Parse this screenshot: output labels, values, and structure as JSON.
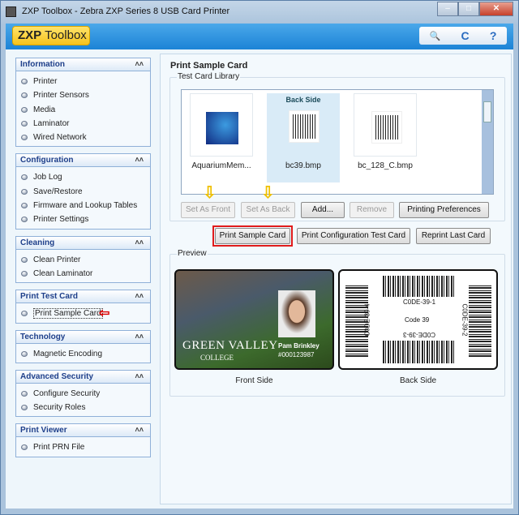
{
  "window": {
    "title": "ZXP Toolbox - Zebra ZXP Series 8 USB Card Printer"
  },
  "header": {
    "logo_bold": "ZXP",
    "logo_rest": " Toolbox",
    "tools": [
      {
        "icon": "search-document-icon",
        "glyph": "🔍"
      },
      {
        "icon": "refresh-icon",
        "glyph": "C"
      },
      {
        "icon": "help-icon",
        "glyph": "?"
      }
    ]
  },
  "sidebar": [
    {
      "title": "Information",
      "items": [
        "Printer",
        "Printer Sensors",
        "Media",
        "Laminator",
        "Wired Network"
      ]
    },
    {
      "title": "Configuration",
      "items": [
        "Job Log",
        "Save/Restore",
        "Firmware and Lookup Tables",
        "Printer Settings"
      ]
    },
    {
      "title": "Cleaning",
      "items": [
        "Clean Printer",
        "Clean Laminator"
      ]
    },
    {
      "title": "Print Test Card",
      "items": [
        "Print Sample Card"
      ],
      "selected": "Print Sample Card"
    },
    {
      "title": "Technology",
      "items": [
        "Magnetic Encoding"
      ]
    },
    {
      "title": "Advanced Security",
      "items": [
        "Configure Security",
        "Security Roles"
      ]
    },
    {
      "title": "Print Viewer",
      "items": [
        "Print PRN File"
      ]
    }
  ],
  "main": {
    "title": "Print Sample Card",
    "library": {
      "label": "Test Card Library",
      "items": [
        {
          "name": "AquariumMem..."
        },
        {
          "name": "bc39.bmp",
          "badge": "Back Side",
          "selected": true
        },
        {
          "name": "bc_128_C.bmp"
        }
      ]
    },
    "library_buttons": {
      "set_front": "Set As Front",
      "set_back": "Set As Back",
      "add": "Add...",
      "remove": "Remove",
      "prefs": "Printing Preferences"
    },
    "print_buttons": {
      "sample": "Print Sample Card",
      "config": "Print Configuration Test Card",
      "reprint": "Reprint Last Card"
    },
    "preview": {
      "label": "Preview",
      "front_label": "Front Side",
      "back_label": "Back Side",
      "front_card": {
        "school": "Green Valley",
        "school_sub": "COLLEGE",
        "name": "Pam Brinkley",
        "id": "#000123987"
      },
      "back_card": {
        "c1": "C0DE-39-1",
        "c2": "C0DE-39-2",
        "c3": "C0DE-39-3",
        "c4": "C0DE-39-4",
        "center": "Code 39"
      }
    }
  },
  "colors": {
    "header_blue": "#1c83d6",
    "logo_yellow": "#f6c31c",
    "highlight_red": "#e01b1b",
    "annotation_arrow": "#f0c000"
  }
}
